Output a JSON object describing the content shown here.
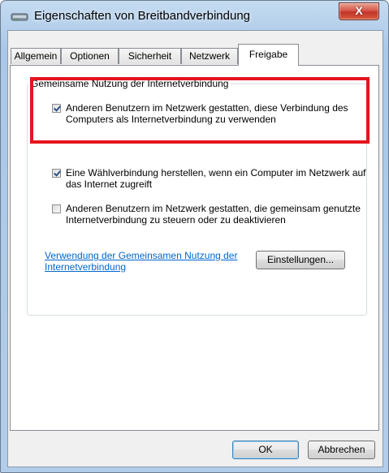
{
  "window": {
    "title": "Eigenschaften von Breitbandverbindung",
    "close_label": "X"
  },
  "tabs": [
    {
      "label": "Allgemein",
      "active": false
    },
    {
      "label": "Optionen",
      "active": false
    },
    {
      "label": "Sicherheit",
      "active": false
    },
    {
      "label": "Netzwerk",
      "active": false
    },
    {
      "label": "Freigabe",
      "active": true
    }
  ],
  "sharing": {
    "group_title": "Gemeinsame Nutzung der Internetverbindung",
    "allow_sharing": {
      "checked": true,
      "label": "Anderen Benutzern im Netzwerk gestatten, diese Verbindung des Computers als Internetverbindung zu verwenden"
    },
    "dial_on_demand": {
      "checked": true,
      "label": "Eine Wählverbindung herstellen, wenn ein Computer im Netzwerk auf das Internet zugreift"
    },
    "allow_control": {
      "checked": false,
      "label": "Anderen Benutzern im Netzwerk gestatten, die gemeinsam genutzte Internetverbindung zu steuern oder zu deaktivieren"
    },
    "help_link": "Verwendung der Gemeinsamen Nutzung der Internetverbindung",
    "settings_button": "Einstellungen..."
  },
  "footer": {
    "ok_label": "OK",
    "cancel_label": "Abbrechen"
  },
  "colors": {
    "highlight": "#e4151e",
    "link": "#0066cc"
  }
}
